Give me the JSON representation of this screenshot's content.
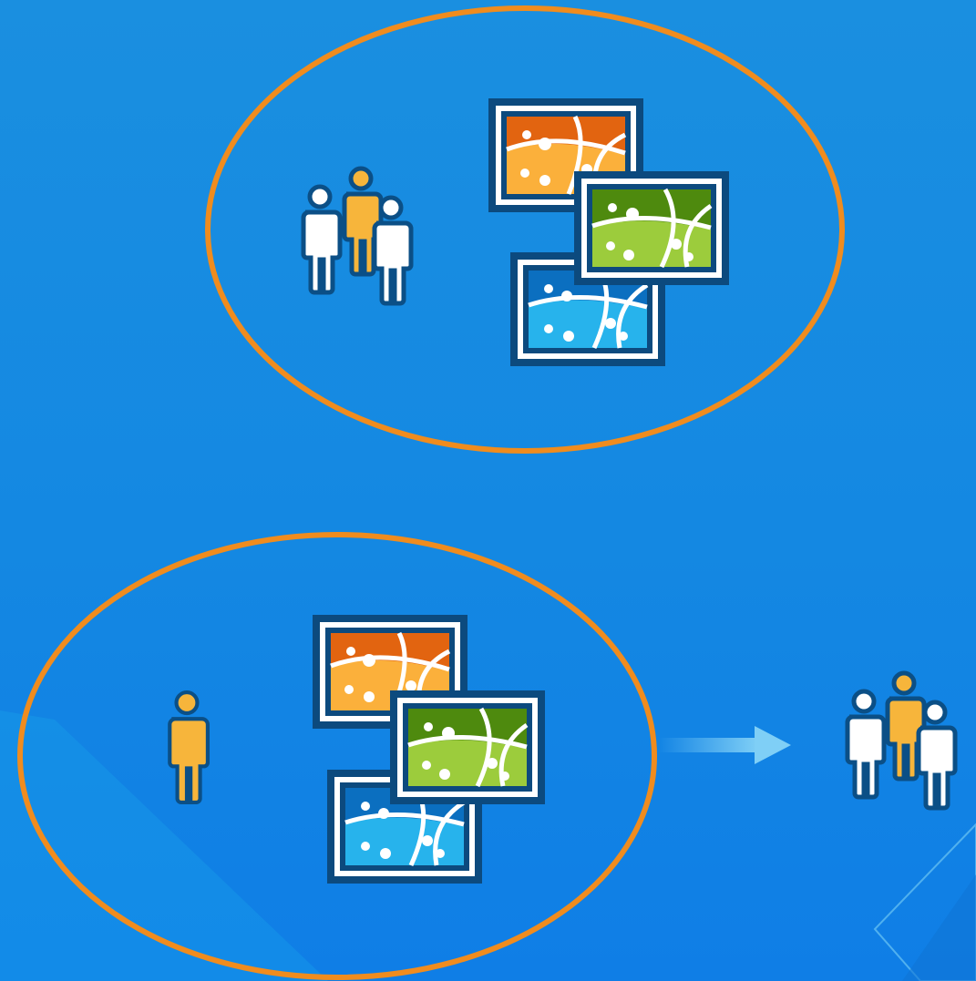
{
  "diagram": {
    "colors": {
      "background": "#1488e2",
      "ellipse_stroke": "#f08c1e",
      "person_orange": "#f7b53b",
      "person_white": "#ffffff",
      "person_outline": "#0b4f86",
      "frame_dark": "#0c4a7e",
      "map_orange_top": "#e26410",
      "map_orange_bottom": "#fbb03b",
      "map_green_top": "#4e8a0e",
      "map_green_bottom": "#9ccc3c",
      "map_blue_top": "#0b6fc0",
      "map_blue_bottom": "#27b3ec",
      "arrow": "#7fcff6"
    },
    "groups": [
      {
        "name": "shared-group",
        "owner": "people-group-icon",
        "items": [
          "map-orange",
          "map-green",
          "map-blue"
        ]
      },
      {
        "name": "single-owner",
        "owner": "single-person-icon",
        "items": [
          "map-orange",
          "map-green",
          "map-blue"
        ],
        "shared_with": "people-group-icon"
      }
    ]
  }
}
